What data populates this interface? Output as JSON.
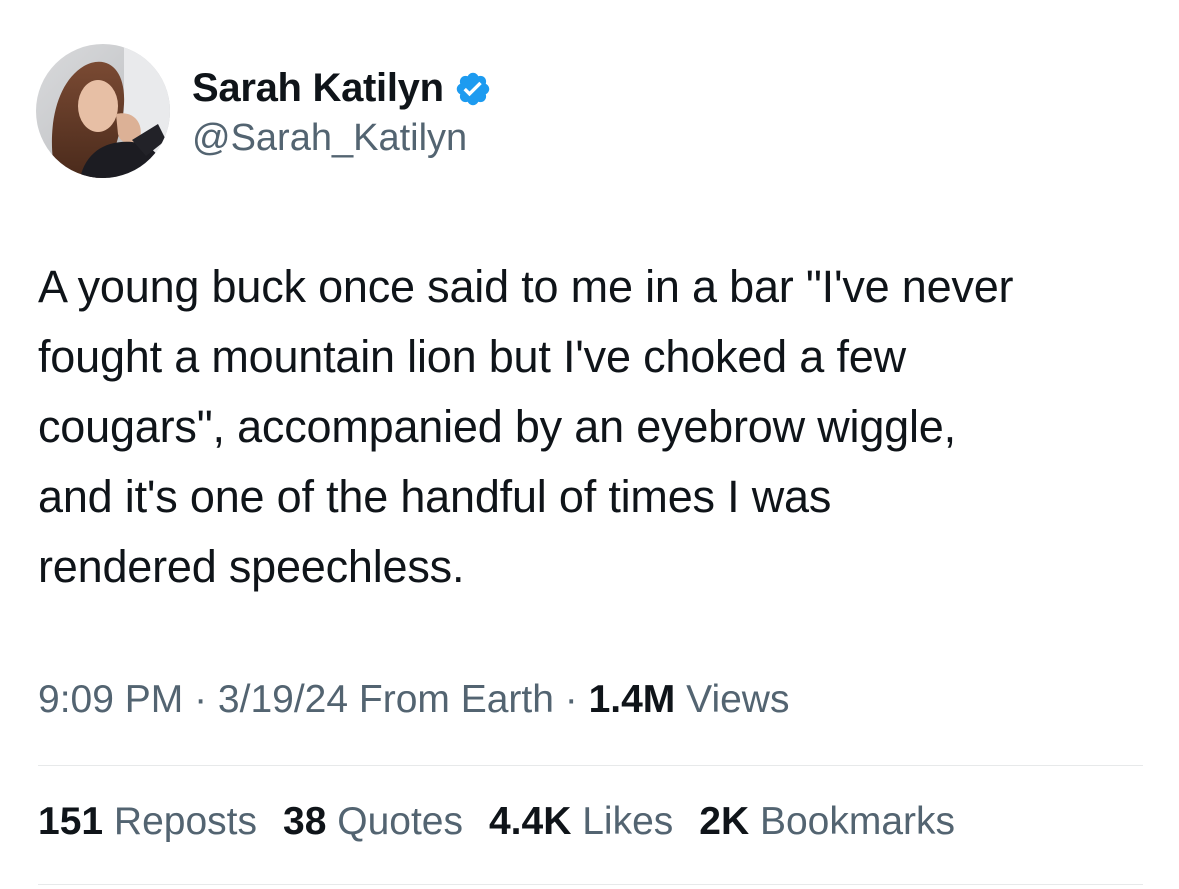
{
  "author": {
    "display_name": "Sarah Katilyn",
    "handle": "@Sarah_Katilyn",
    "verified_icon": "verified-badge-icon",
    "badge_color": "#1d9bf0"
  },
  "tweet": {
    "text": "A young buck once said to me in a bar \"I've never\nfought a mountain lion but I've choked a few\ncougars\", accompanied by an eyebrow wiggle,\nand it's one of the handful of times I was\nrendered speechless."
  },
  "meta": {
    "time": "9:09 PM",
    "separator": " · ",
    "date_source": "3/19/24 From Earth",
    "views_count": "1.4M",
    "views_label": "Views"
  },
  "stats": {
    "reposts_count": "151",
    "reposts_label": "Reposts",
    "quotes_count": "38",
    "quotes_label": "Quotes",
    "likes_count": "4.4K",
    "likes_label": "Likes",
    "bookmarks_count": "2K",
    "bookmarks_label": "Bookmarks"
  },
  "colors": {
    "text_primary": "#0f1419",
    "text_secondary": "#536471",
    "divider": "#e7e9ea"
  }
}
